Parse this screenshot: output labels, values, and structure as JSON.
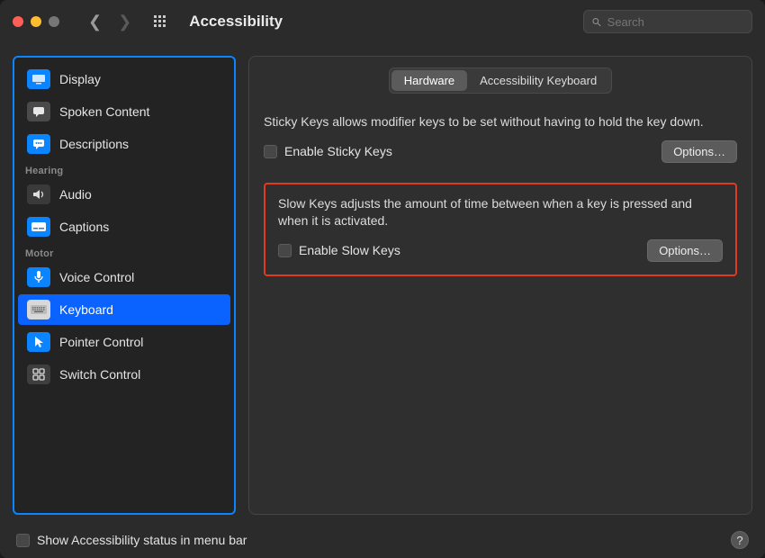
{
  "header": {
    "title": "Accessibility",
    "search_placeholder": "Search"
  },
  "sidebar": {
    "categories": [
      {
        "name": "",
        "items": [
          {
            "id": "display",
            "label": "Display"
          },
          {
            "id": "spoken",
            "label": "Spoken Content"
          },
          {
            "id": "desc",
            "label": "Descriptions"
          }
        ]
      },
      {
        "name": "Hearing",
        "items": [
          {
            "id": "audio",
            "label": "Audio"
          },
          {
            "id": "captions",
            "label": "Captions"
          }
        ]
      },
      {
        "name": "Motor",
        "items": [
          {
            "id": "voice",
            "label": "Voice Control"
          },
          {
            "id": "keyboard",
            "label": "Keyboard",
            "selected": true
          },
          {
            "id": "pointer",
            "label": "Pointer Control"
          },
          {
            "id": "switch",
            "label": "Switch Control"
          }
        ]
      }
    ]
  },
  "panel": {
    "tabs": {
      "hardware": "Hardware",
      "akbd": "Accessibility Keyboard",
      "active": "hardware"
    },
    "sticky": {
      "desc": "Sticky Keys allows modifier keys to be set without having to hold the key down.",
      "checkbox": "Enable Sticky Keys",
      "options": "Options…"
    },
    "slow": {
      "desc": "Slow Keys adjusts the amount of time between when a key is pressed and when it is activated.",
      "checkbox": "Enable Slow Keys",
      "options": "Options…"
    }
  },
  "footer": {
    "label": "Show Accessibility status in menu bar"
  },
  "colors": {
    "accent": "#0a63ff",
    "highlight": "#e13a1e"
  }
}
